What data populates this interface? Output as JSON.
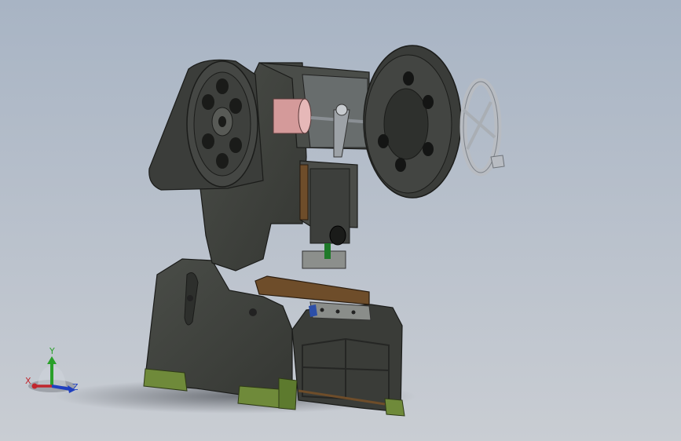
{
  "viewport": {
    "background_top": "#a8b4c4",
    "background_bottom": "#c9cdd3"
  },
  "model": {
    "body_color": "#3f423e",
    "edge_color": "#1b1c1a",
    "flywheel_color": "#3a3c39",
    "motor_color": "#d9a3a3",
    "gear_color": "#1f7a2a",
    "brass_color": "#6e4d2a",
    "pad_color": "#6f8a3a",
    "handwheel_color": "#b8bcc2"
  },
  "triad": {
    "x_label": "X",
    "y_label": "Y",
    "z_label": "Z",
    "x_color": "#c0262d",
    "y_color": "#2aa02a",
    "z_color": "#1f3fbf"
  }
}
